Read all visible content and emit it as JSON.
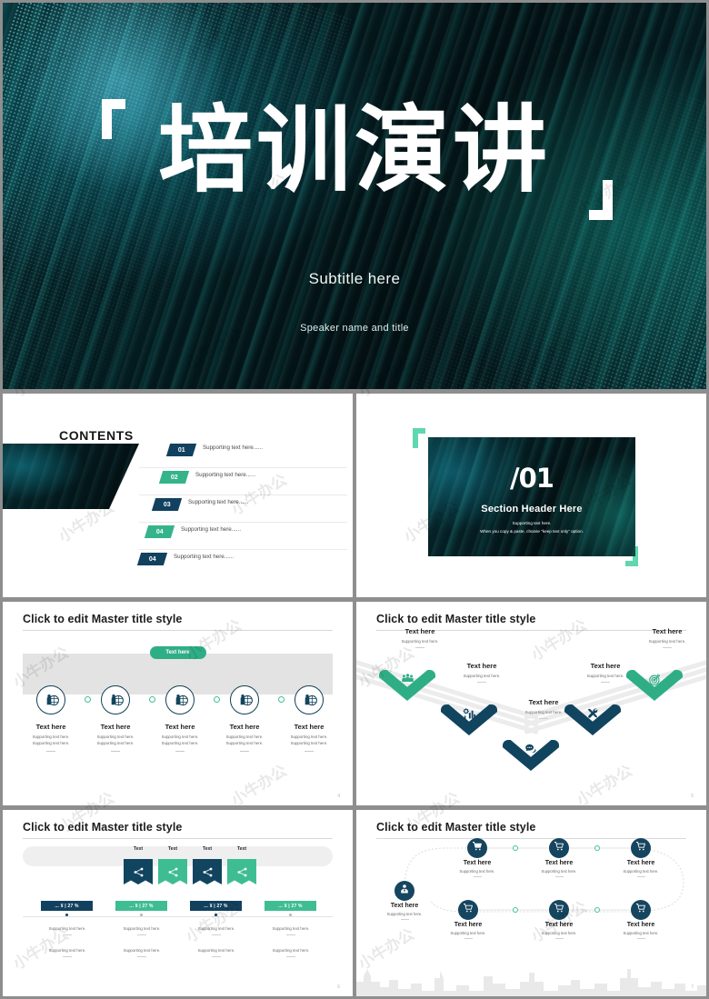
{
  "cover": {
    "title": "培训演讲",
    "subtitle": "Subtitle here",
    "speaker": "Speaker name and title"
  },
  "contents_slide": {
    "heading": "CONTENTS",
    "items": [
      {
        "number": "01",
        "text": "Supporting text here......",
        "color": "#12415f"
      },
      {
        "number": "02",
        "text": "Supporting text here......",
        "color": "#35b38a"
      },
      {
        "number": "03",
        "text": "Supporting text here......",
        "color": "#12415f"
      },
      {
        "number": "04",
        "text": "Supporting text here......",
        "color": "#35b38a"
      },
      {
        "number": "04",
        "text": "Supporting text here......",
        "color": "#12415f"
      }
    ]
  },
  "section_slide": {
    "number": "/01",
    "header": "Section Header Here",
    "support_line1": "Supporting text here.",
    "support_line2": "When you copy & paste, choose \"keep text only\" option."
  },
  "steps_slide": {
    "title": "Click to edit Master title style",
    "pill": "Text here",
    "page_number": "4",
    "steps": [
      {
        "heading": "Text here",
        "line1": "Supporting text here.",
        "line2": "Supporting text here.",
        "icon": "person-globe-icon"
      },
      {
        "heading": "Text here",
        "line1": "Supporting text here.",
        "line2": "Supporting text here.",
        "icon": "person-globe-icon"
      },
      {
        "heading": "Text here",
        "line1": "Supporting text here.",
        "line2": "Supporting text here.",
        "icon": "person-globe-icon"
      },
      {
        "heading": "Text here",
        "line1": "Supporting text here.",
        "line2": "Supporting text here.",
        "icon": "person-globe-icon"
      },
      {
        "heading": "Text here",
        "line1": "Supporting text here.",
        "line2": "Supporting text here.",
        "icon": "person-globe-icon"
      }
    ]
  },
  "chevrons_slide": {
    "title": "Click to edit Master title style",
    "page_number": "5",
    "nodes": [
      {
        "heading": "Text here",
        "support": "Supporting text here.",
        "icon": "group-people-icon",
        "color": "#2fae86"
      },
      {
        "heading": "Text here",
        "support": "Supporting text here.",
        "icon": "bar-chart-gear-icon",
        "color": "#11445f"
      },
      {
        "heading": "Text here",
        "support": "Supporting text here.",
        "icon": "chat-bubbles-icon",
        "color": "#11445f"
      },
      {
        "heading": "Text here",
        "support": "Supporting text here.",
        "icon": "tools-icon",
        "color": "#11445f"
      },
      {
        "heading": "Text here",
        "support": "Supporting text here.",
        "icon": "target-icon",
        "color": "#2fae86"
      }
    ]
  },
  "ribbons_slide": {
    "title": "Click to edit Master title style",
    "page_number": "6",
    "ribbons": [
      {
        "label": "Text",
        "color": "#11445f",
        "icon": "network-share-icon"
      },
      {
        "label": "Text",
        "color": "#3fbd92",
        "icon": "network-share-icon"
      },
      {
        "label": "Text",
        "color": "#11445f",
        "icon": "network-share-icon"
      },
      {
        "label": "Text",
        "color": "#3fbd92",
        "icon": "network-share-icon"
      }
    ],
    "metrics": [
      {
        "value": "... ¥ | 27 %",
        "color": "#12415f",
        "line1": "Supporting text here.",
        "line2": "Supporting text here."
      },
      {
        "value": "... ¥ | 27 %",
        "color": "#3fbd92",
        "line1": "Supporting text here.",
        "line2": "Supporting text here."
      },
      {
        "value": "... ¥ | 27 %",
        "color": "#12415f",
        "line1": "Supporting text here.",
        "line2": "Supporting text here."
      },
      {
        "value": "... ¥ | 27 %",
        "color": "#3fbd92",
        "line1": "Supporting text here.",
        "line2": "Supporting text here."
      }
    ]
  },
  "loop_slide": {
    "title": "Click to edit Master title style",
    "page_number": "7",
    "start_node": {
      "heading": "Text here",
      "support": "Supporting text here.",
      "icon": "user-tie-icon"
    },
    "nodes": [
      {
        "heading": "Text here",
        "support": "Supporting text here.",
        "icon": "shopping-cart-icon"
      },
      {
        "heading": "Text here",
        "support": "Supporting text here.",
        "icon": "shopping-cart-icon"
      },
      {
        "heading": "Text here",
        "support": "Supporting text here.",
        "icon": "shopping-cart-icon"
      },
      {
        "heading": "Text here",
        "support": "Supporting text here.",
        "icon": "shopping-cart-icon"
      },
      {
        "heading": "Text here",
        "support": "Supporting text here.",
        "icon": "shopping-cart-icon"
      },
      {
        "heading": "Text here",
        "support": "Supporting text here.",
        "icon": "shopping-cart-icon"
      }
    ]
  },
  "theme": {
    "navy": "#12415f",
    "teal": "#35b38a",
    "dark_bg": "#031a1e",
    "page_bg": "#8e8e8e"
  },
  "watermark": {
    "text": "小牛办公"
  }
}
